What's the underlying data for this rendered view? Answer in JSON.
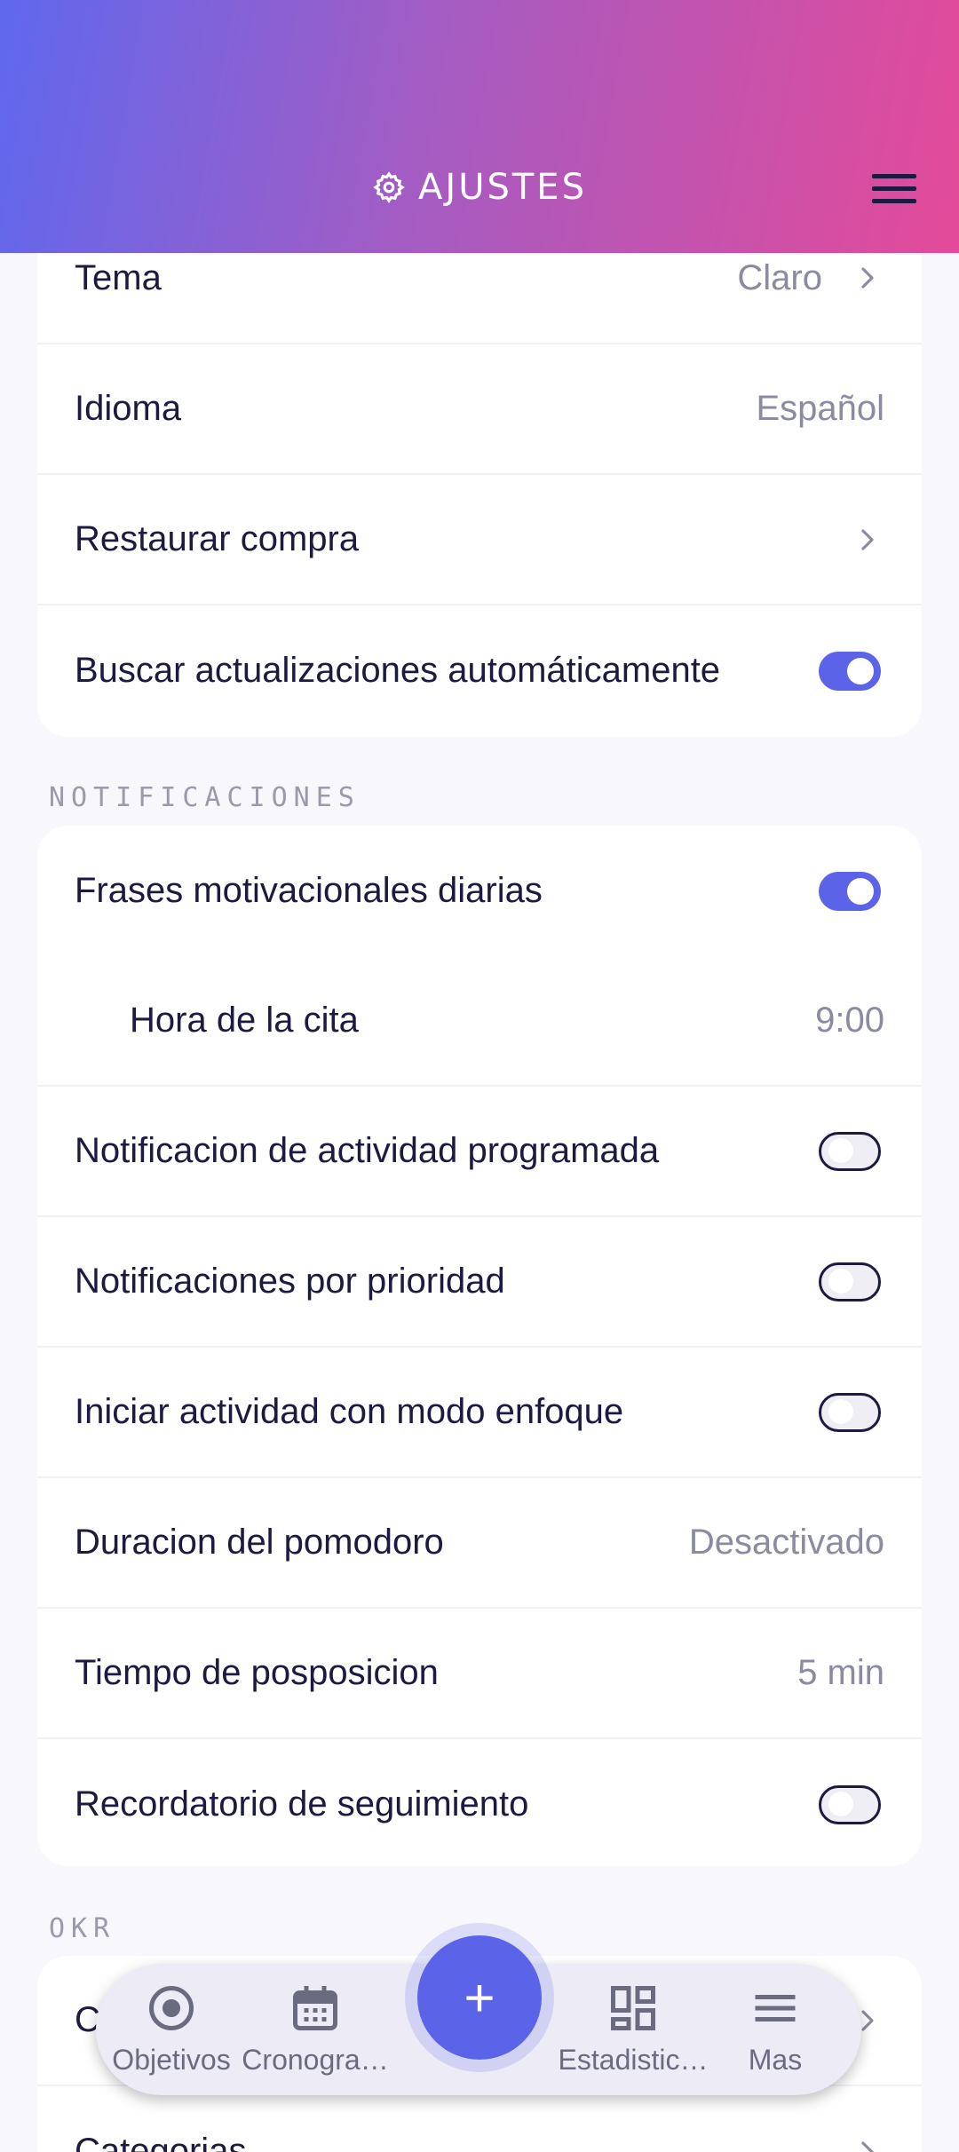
{
  "header": {
    "title": "AJUSTES",
    "title_icon": "gear-icon",
    "menu_icon": "hamburger-menu-icon"
  },
  "general": {
    "rows": [
      {
        "label": "Tema",
        "value": "Claro"
      },
      {
        "label": "Idioma",
        "value": "Español"
      },
      {
        "label": "Restaurar compra"
      },
      {
        "label": "Buscar actualizaciones automáticamente",
        "toggle": true
      }
    ]
  },
  "notifications": {
    "section_title": "NOTIFICACIONES",
    "rows": [
      {
        "label": "Frases motivacionales diarias",
        "toggle": true
      },
      {
        "label": "Hora de la cita",
        "value": "9:00"
      },
      {
        "label": "Notificacion de actividad programada",
        "toggle": false
      },
      {
        "label": "Notificaciones por prioridad",
        "toggle": false
      },
      {
        "label": "Iniciar actividad con modo enfoque",
        "toggle": false
      },
      {
        "label": "Duracion del pomodoro",
        "value": "Desactivado"
      },
      {
        "label": "Tiempo de posposicion",
        "value": "5 min"
      },
      {
        "label": "Recordatorio de seguimiento",
        "toggle": false
      }
    ]
  },
  "okr": {
    "section_title": "OKR",
    "rows": [
      {
        "label": "C"
      },
      {
        "label": "Categorias"
      }
    ]
  },
  "bottom_nav": {
    "items": [
      {
        "label": "Objetivos",
        "icon": "target-icon"
      },
      {
        "label": "Cronogra…",
        "icon": "calendar-icon"
      },
      {
        "label": "Estadistic…",
        "icon": "dashboard-icon"
      },
      {
        "label": "Mas",
        "icon": "menu-icon"
      }
    ],
    "fab_label": "+"
  },
  "colors": {
    "accent": "#5b64e8",
    "gradient_start": "#5f68ee",
    "gradient_end": "#e44a99",
    "text": "#1c1a40",
    "muted": "#8a8aa2"
  }
}
